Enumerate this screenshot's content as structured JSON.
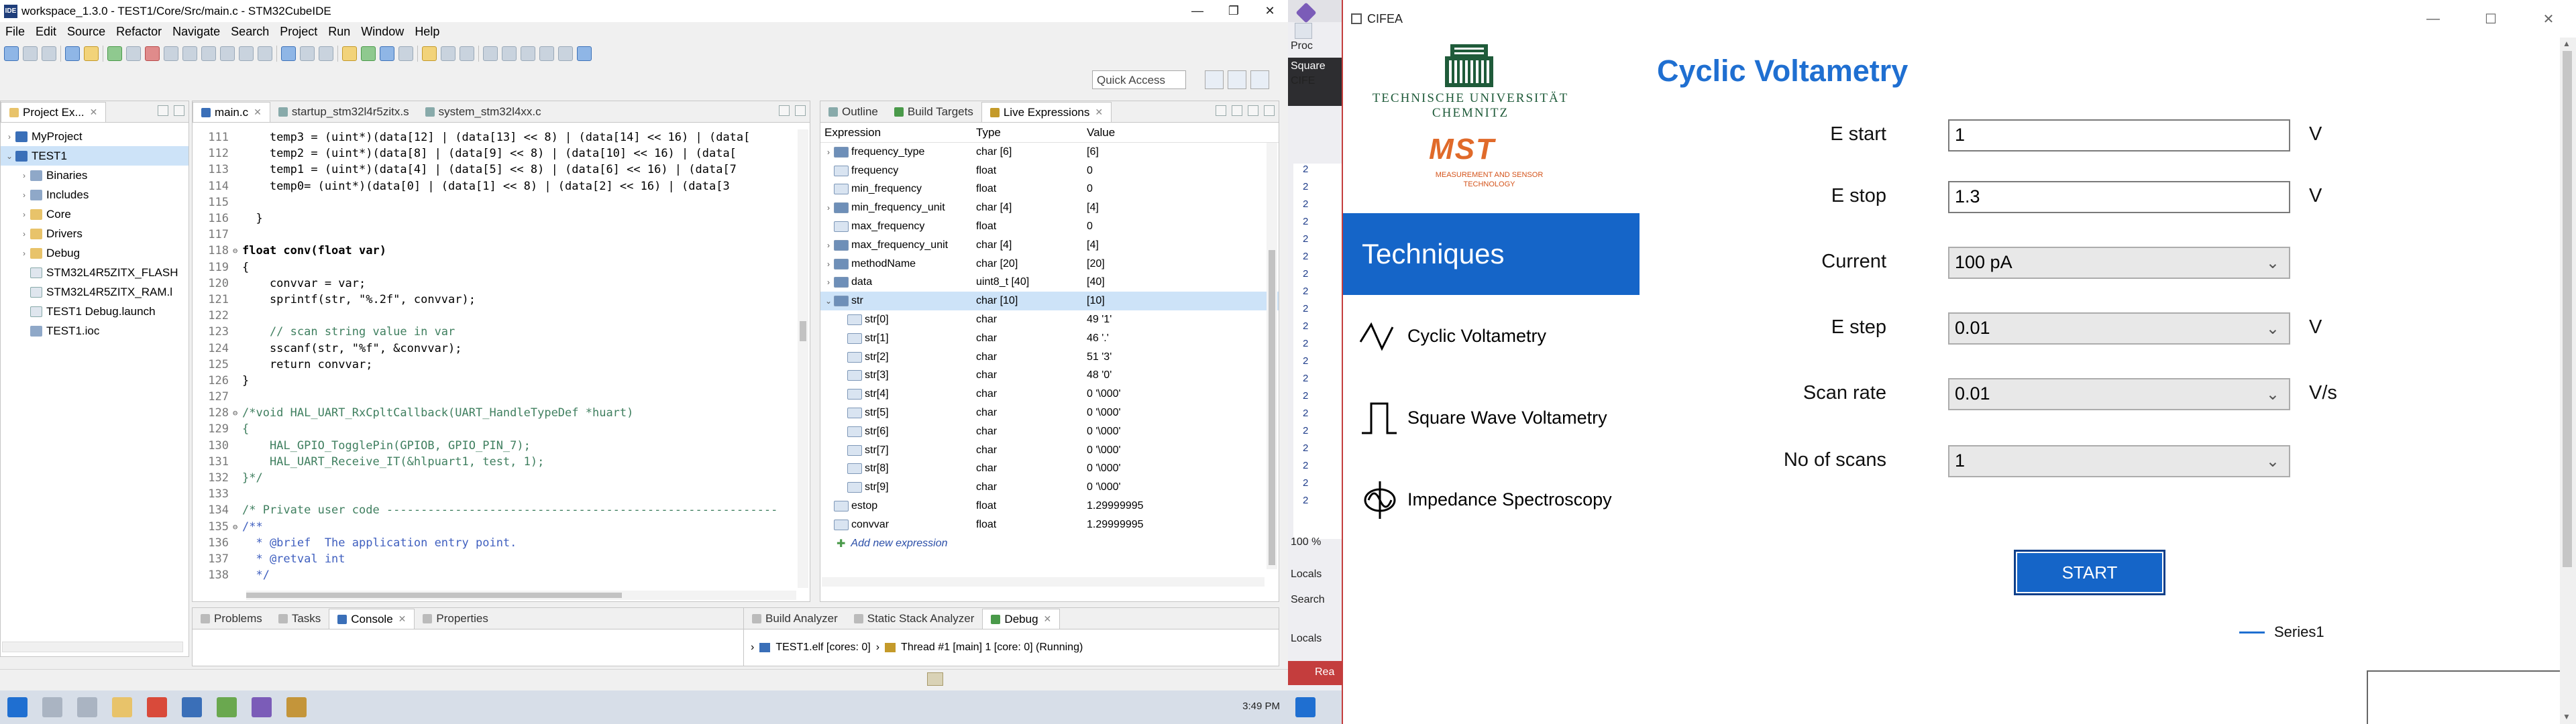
{
  "ide": {
    "title": "workspace_1.3.0 - TEST1/Core/Src/main.c - STM32CubeIDE",
    "menu": [
      "File",
      "Edit",
      "Source",
      "Refactor",
      "Navigate",
      "Search",
      "Project",
      "Run",
      "Window",
      "Help"
    ],
    "quick_access": "Quick Access",
    "explorer": {
      "tab": "Project Ex...",
      "items": [
        {
          "label": "MyProject",
          "indent": 0,
          "arrow": ">",
          "icon": "proj"
        },
        {
          "label": "TEST1",
          "indent": 0,
          "arrow": "v",
          "icon": "proj"
        },
        {
          "label": "Binaries",
          "indent": 1,
          "arrow": ">",
          "icon": "bin"
        },
        {
          "label": "Includes",
          "indent": 1,
          "arrow": ">",
          "icon": "bin"
        },
        {
          "label": "Core",
          "indent": 1,
          "arrow": ">",
          "icon": "folder"
        },
        {
          "label": "Drivers",
          "indent": 1,
          "arrow": ">",
          "icon": "folder"
        },
        {
          "label": "Debug",
          "indent": 1,
          "arrow": ">",
          "icon": "folder"
        },
        {
          "label": "STM32L4R5ZITX_FLASH",
          "indent": 1,
          "arrow": "",
          "icon": "file"
        },
        {
          "label": "STM32L4R5ZITX_RAM.l",
          "indent": 1,
          "arrow": "",
          "icon": "file"
        },
        {
          "label": "TEST1 Debug.launch",
          "indent": 1,
          "arrow": "",
          "icon": "file"
        },
        {
          "label": "TEST1.ioc",
          "indent": 1,
          "arrow": "",
          "icon": "bin"
        }
      ]
    },
    "editor": {
      "tabs": [
        "main.c",
        "startup_stm32l4r5zitx.s",
        "system_stm32l4xx.c"
      ],
      "lines": [
        {
          "n": "111",
          "f": "",
          "t": "    temp3 = (uint*)(data[12] | (data[13] << 8) | (data[14] << 16) | (data["
        },
        {
          "n": "112",
          "f": "",
          "t": "    temp2 = (uint*)(data[8] | (data[9] << 8) | (data[10] << 16) | (data["
        },
        {
          "n": "113",
          "f": "",
          "t": "    temp1 = (uint*)(data[4] | (data[5] << 8) | (data[6] << 16) | (data[7"
        },
        {
          "n": "114",
          "f": "",
          "t": "    temp0= (uint*)(data[0] | (data[1] << 8) | (data[2] << 16) | (data[3"
        },
        {
          "n": "115",
          "f": "",
          "t": ""
        },
        {
          "n": "116",
          "f": "",
          "t": "  }"
        },
        {
          "n": "117",
          "f": "",
          "t": ""
        },
        {
          "n": "118",
          "f": "⊖",
          "t": "float conv(float var)"
        },
        {
          "n": "119",
          "f": "",
          "t": "{"
        },
        {
          "n": "120",
          "f": "",
          "t": "    convvar = var;"
        },
        {
          "n": "121",
          "f": "",
          "t": "    sprintf(str, \"%.2f\", convvar);"
        },
        {
          "n": "122",
          "f": "",
          "t": ""
        },
        {
          "n": "123",
          "f": "",
          "t": "    // scan string value in var"
        },
        {
          "n": "124",
          "f": "",
          "t": "    sscanf(str, \"%f\", &convvar);"
        },
        {
          "n": "125",
          "f": "",
          "t": "    return convvar;"
        },
        {
          "n": "126",
          "f": "",
          "t": "}"
        },
        {
          "n": "127",
          "f": "",
          "t": ""
        },
        {
          "n": "128",
          "f": "⊖",
          "t": "/*void HAL_UART_RxCpltCallback(UART_HandleTypeDef *huart)"
        },
        {
          "n": "129",
          "f": "",
          "t": "{"
        },
        {
          "n": "130",
          "f": "",
          "t": "    HAL_GPIO_TogglePin(GPIOB, GPIO_PIN_7);"
        },
        {
          "n": "131",
          "f": "",
          "t": "    HAL_UART_Receive_IT(&hlpuart1, test, 1);"
        },
        {
          "n": "132",
          "f": "",
          "t": "}*/"
        },
        {
          "n": "133",
          "f": "",
          "t": ""
        },
        {
          "n": "134",
          "f": "",
          "t": "/* Private user code ---------------------------------------------------------"
        },
        {
          "n": "135",
          "f": "⊖",
          "t": "/**"
        },
        {
          "n": "136",
          "f": "",
          "t": "  * @brief  The application entry point."
        },
        {
          "n": "137",
          "f": "",
          "t": "  * @retval int"
        },
        {
          "n": "138",
          "f": "",
          "t": "  */"
        }
      ]
    },
    "live": {
      "tabs": [
        "Outline",
        "Build Targets",
        "Live Expressions"
      ],
      "headers": [
        "Expression",
        "Type",
        "Value"
      ],
      "rows": [
        {
          "e": "frequency_type",
          "t": "char [6]",
          "v": "[6]",
          "lvl": 0,
          "exp": ">",
          "arr": true
        },
        {
          "e": "frequency",
          "t": "float",
          "v": "0",
          "lvl": 0,
          "exp": "",
          "arr": false
        },
        {
          "e": "min_frequency",
          "t": "float",
          "v": "0",
          "lvl": 0,
          "exp": "",
          "arr": false
        },
        {
          "e": "min_frequency_unit",
          "t": "char [4]",
          "v": "[4]",
          "lvl": 0,
          "exp": ">",
          "arr": true
        },
        {
          "e": "max_frequency",
          "t": "float",
          "v": "0",
          "lvl": 0,
          "exp": "",
          "arr": false
        },
        {
          "e": "max_frequency_unit",
          "t": "char [4]",
          "v": "[4]",
          "lvl": 0,
          "exp": ">",
          "arr": true
        },
        {
          "e": "methodName",
          "t": "char [20]",
          "v": "[20]",
          "lvl": 0,
          "exp": ">",
          "arr": true
        },
        {
          "e": "data",
          "t": "uint8_t [40]",
          "v": "[40]",
          "lvl": 0,
          "exp": ">",
          "arr": true
        },
        {
          "e": "str",
          "t": "char [10]",
          "v": "[10]",
          "lvl": 0,
          "exp": "v",
          "arr": true
        },
        {
          "e": "str[0]",
          "t": "char",
          "v": "49 '1'",
          "lvl": 1,
          "exp": "",
          "arr": false
        },
        {
          "e": "str[1]",
          "t": "char",
          "v": "46 '.'",
          "lvl": 1,
          "exp": "",
          "arr": false
        },
        {
          "e": "str[2]",
          "t": "char",
          "v": "51 '3'",
          "lvl": 1,
          "exp": "",
          "arr": false
        },
        {
          "e": "str[3]",
          "t": "char",
          "v": "48 '0'",
          "lvl": 1,
          "exp": "",
          "arr": false
        },
        {
          "e": "str[4]",
          "t": "char",
          "v": "0 '\\000'",
          "lvl": 1,
          "exp": "",
          "arr": false
        },
        {
          "e": "str[5]",
          "t": "char",
          "v": "0 '\\000'",
          "lvl": 1,
          "exp": "",
          "arr": false
        },
        {
          "e": "str[6]",
          "t": "char",
          "v": "0 '\\000'",
          "lvl": 1,
          "exp": "",
          "arr": false
        },
        {
          "e": "str[7]",
          "t": "char",
          "v": "0 '\\000'",
          "lvl": 1,
          "exp": "",
          "arr": false
        },
        {
          "e": "str[8]",
          "t": "char",
          "v": "0 '\\000'",
          "lvl": 1,
          "exp": "",
          "arr": false
        },
        {
          "e": "str[9]",
          "t": "char",
          "v": "0 '\\000'",
          "lvl": 1,
          "exp": "",
          "arr": false
        },
        {
          "e": "estop",
          "t": "float",
          "v": "1.29999995",
          "lvl": 0,
          "exp": "",
          "arr": false
        },
        {
          "e": "convvar",
          "t": "float",
          "v": "1.29999995",
          "lvl": 0,
          "exp": "",
          "arr": false
        }
      ],
      "add_label": "Add new expression"
    },
    "bottom_tabs": [
      "Problems",
      "Tasks",
      "Console",
      "Properties"
    ],
    "debug_tabs": [
      "Build Analyzer",
      "Static Stack Analyzer",
      "Debug"
    ],
    "debug_thread": {
      "elf": "TEST1.elf [cores: 0]",
      "thread": "Thread #1 [main] 1 [core: 0] (Running)"
    },
    "clock": "3:49 PM"
  },
  "vs": {
    "labels": [
      "Proc",
      "Square",
      "CIFE",
      "100 %",
      "Locals",
      "Search",
      "Locals",
      "Rea"
    ],
    "tree_items": [
      "2",
      "2",
      "2",
      "2",
      "2",
      "2",
      "2",
      "2",
      "2",
      "2",
      "2",
      "2",
      "2",
      "2",
      "2",
      "2",
      "2",
      "2",
      "2",
      "2"
    ]
  },
  "cifea": {
    "title": "CIFEA",
    "university": "TECHNISCHE UNIVERSITÄT CHEMNITZ",
    "mst": "MST",
    "mst_sub": "MEASUREMENT AND SENSOR TECHNOLOGY",
    "techniques": "Techniques",
    "menu": [
      "Cyclic Voltametry",
      "Square Wave Voltametry",
      "Impedance Spectroscopy"
    ],
    "heading": "Cyclic Voltametry",
    "params": [
      {
        "label": "E start",
        "value": "1",
        "kind": "input",
        "unit": "V"
      },
      {
        "label": "E stop",
        "value": "1.3",
        "kind": "input",
        "unit": "V"
      },
      {
        "label": "Current",
        "value": "100 pA",
        "kind": "select",
        "unit": ""
      },
      {
        "label": "E step",
        "value": "0.01",
        "kind": "select",
        "unit": "V"
      },
      {
        "label": "Scan rate",
        "value": "0.01",
        "kind": "select",
        "unit": "V/s"
      },
      {
        "label": "No of scans",
        "value": "1",
        "kind": "select",
        "unit": ""
      }
    ],
    "start": "START",
    "legend": "Series1",
    "colors": {
      "accent": "#1565c8",
      "heading": "#1f6fd1"
    }
  }
}
